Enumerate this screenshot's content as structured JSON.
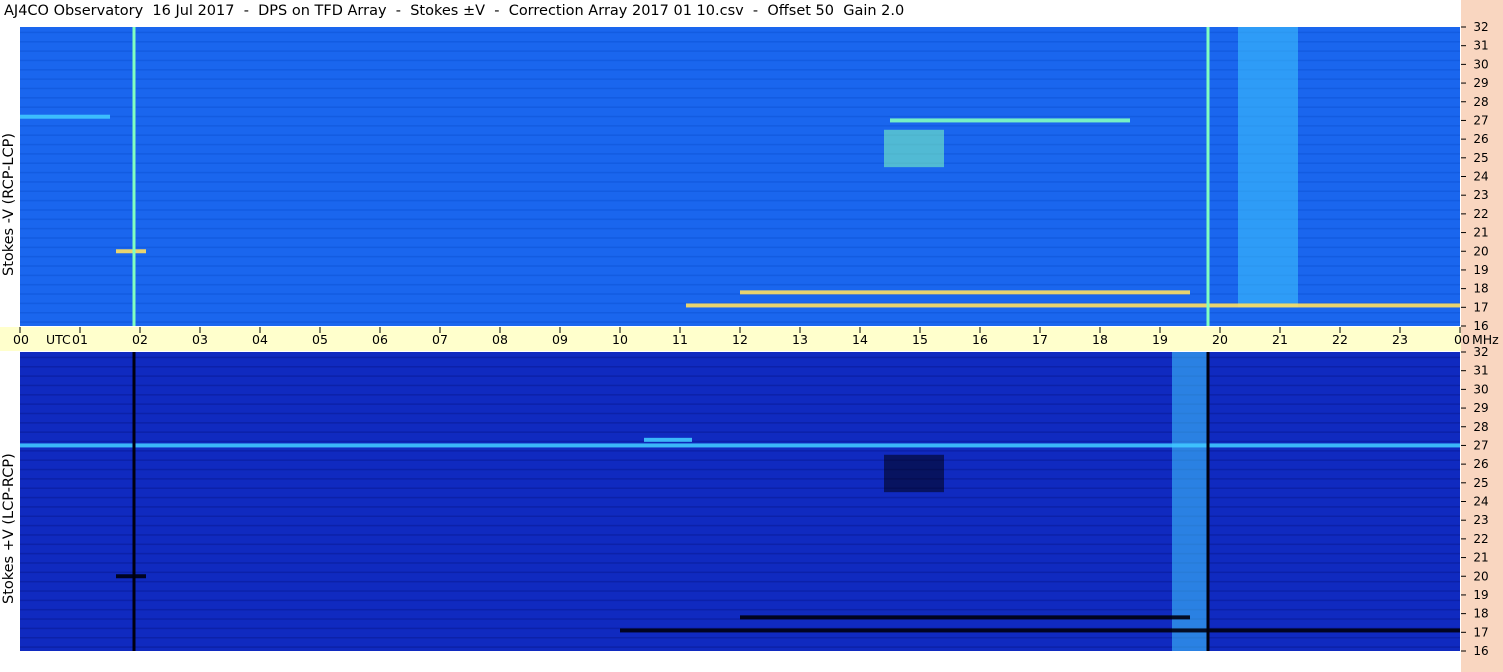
{
  "title": "AJ4CO Observatory  16 Jul 2017  -  DPS on TFD Array  -  Stokes ±V  -  Correction Array 2017 01 10.csv  -  Offset 50  Gain 2.0",
  "colors": {
    "top_base": "#1a66ee",
    "bottom_base": "#102ac0",
    "time_strip": "#ffffcc",
    "right_strip": "#f9d6c0"
  },
  "chart_data": [
    {
      "type": "heatmap",
      "panel": "top",
      "ylabel": "Stokes -V (RCP-LCP)",
      "x_unit": "UTC",
      "x_ticks": [
        "00",
        "01",
        "02",
        "03",
        "04",
        "05",
        "06",
        "07",
        "08",
        "09",
        "10",
        "11",
        "12",
        "13",
        "14",
        "15",
        "16",
        "17",
        "18",
        "19",
        "20",
        "21",
        "22",
        "23",
        "00"
      ],
      "xlim": [
        0,
        24
      ],
      "y_unit": "MHz",
      "y_ticks": [
        16,
        17,
        18,
        19,
        20,
        21,
        22,
        23,
        24,
        25,
        26,
        27,
        28,
        29,
        30,
        31,
        32
      ],
      "ylim": [
        16,
        32
      ],
      "bands": [
        {
          "y": 17.1,
          "x": [
            11.1,
            24
          ],
          "level": 0.85
        },
        {
          "y": 17.8,
          "x": [
            12,
            19.5
          ],
          "level": 0.9
        },
        {
          "y": 20.0,
          "x": [
            1.6,
            2.1
          ],
          "level": 0.8
        },
        {
          "y": 27.0,
          "x": [
            14.5,
            18.5
          ],
          "level": 0.6
        },
        {
          "y": 27.2,
          "x": [
            0,
            1.5
          ],
          "level": 0.4
        }
      ],
      "vertical_lines": [
        {
          "x": 1.9,
          "level": 0.7
        },
        {
          "x": 19.8,
          "level": 0.75
        }
      ],
      "bursts": [
        {
          "x": [
            14.4,
            15.4
          ],
          "y": [
            24.5,
            26.5
          ],
          "level": 0.6
        },
        {
          "x": [
            20.3,
            21.3
          ],
          "y": [
            17,
            32
          ],
          "level": 0.45
        }
      ]
    },
    {
      "type": "heatmap",
      "panel": "bottom",
      "ylabel": "Stokes +V (LCP-RCP)",
      "x_unit": "UTC",
      "x_ticks": [
        "00",
        "01",
        "02",
        "03",
        "04",
        "05",
        "06",
        "07",
        "08",
        "09",
        "10",
        "11",
        "12",
        "13",
        "14",
        "15",
        "16",
        "17",
        "18",
        "19",
        "20",
        "21",
        "22",
        "23",
        "00"
      ],
      "xlim": [
        0,
        24
      ],
      "y_unit": "MHz",
      "y_ticks": [
        16,
        17,
        18,
        19,
        20,
        21,
        22,
        23,
        24,
        25,
        26,
        27,
        28,
        29,
        30,
        31,
        32
      ],
      "ylim": [
        16,
        32
      ],
      "bands": [
        {
          "y": 17.1,
          "x": [
            10,
            24
          ],
          "level": -0.7
        },
        {
          "y": 17.8,
          "x": [
            12,
            19.5
          ],
          "level": -0.75
        },
        {
          "y": 20.0,
          "x": [
            1.6,
            2.1
          ],
          "level": -0.7
        },
        {
          "y": 27.0,
          "x": [
            0,
            24
          ],
          "level": 0.4
        },
        {
          "y": 27.3,
          "x": [
            10.4,
            11.2
          ],
          "level": 0.5
        }
      ],
      "vertical_lines": [
        {
          "x": 1.9,
          "level": -0.9
        },
        {
          "x": 19.8,
          "level": -0.9
        }
      ],
      "bursts": [
        {
          "x": [
            14.4,
            15.4
          ],
          "y": [
            24.5,
            26.5
          ],
          "level": -0.8
        },
        {
          "x": [
            19.2,
            19.8
          ],
          "y": [
            16,
            32
          ],
          "level": 0.4
        }
      ]
    }
  ]
}
